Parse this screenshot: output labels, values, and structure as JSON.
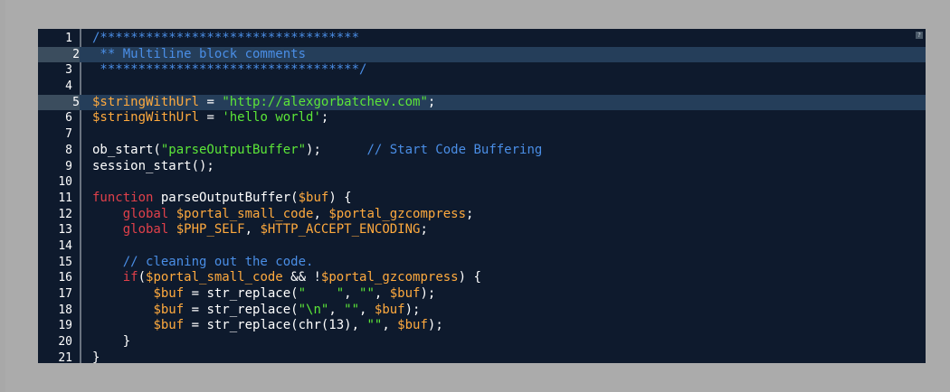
{
  "toolbar": {
    "help_label": "?"
  },
  "colors": {
    "comment": "#4a8ee6",
    "variable": "#ffaa3e",
    "string": "#5ce638",
    "keyword": "#e0404a",
    "plain": "#ffffff",
    "background": "#0e1a2d",
    "highlight": "#253e5a"
  },
  "editor": {
    "highlighted_lines": [
      2,
      5
    ],
    "lines": [
      {
        "n": "1",
        "tokens": [
          [
            "comment",
            "/**********************************"
          ]
        ]
      },
      {
        "n": "2",
        "tokens": [
          [
            "comment",
            " ** Multiline block comments"
          ]
        ]
      },
      {
        "n": "3",
        "tokens": [
          [
            "comment",
            " **********************************/"
          ]
        ]
      },
      {
        "n": "4",
        "tokens": []
      },
      {
        "n": "5",
        "tokens": [
          [
            "var",
            "$stringWithUrl"
          ],
          [
            "plain",
            " = "
          ],
          [
            "str",
            "\"http://alexgorbatchev.com\""
          ],
          [
            "plain",
            ";"
          ]
        ]
      },
      {
        "n": "6",
        "tokens": [
          [
            "var",
            "$stringWithUrl"
          ],
          [
            "plain",
            " = "
          ],
          [
            "str",
            "'hello world'"
          ],
          [
            "plain",
            ";"
          ]
        ]
      },
      {
        "n": "7",
        "tokens": []
      },
      {
        "n": "8",
        "tokens": [
          [
            "plain",
            "ob_start("
          ],
          [
            "str",
            "\"parseOutputBuffer\""
          ],
          [
            "plain",
            ");      "
          ],
          [
            "comment",
            "// Start Code Buffering"
          ]
        ]
      },
      {
        "n": "9",
        "tokens": [
          [
            "plain",
            "session_start();"
          ]
        ]
      },
      {
        "n": "10",
        "tokens": []
      },
      {
        "n": "11",
        "tokens": [
          [
            "kw",
            "function"
          ],
          [
            "plain",
            " parseOutputBuffer("
          ],
          [
            "var",
            "$buf"
          ],
          [
            "plain",
            ") {"
          ]
        ]
      },
      {
        "n": "12",
        "tokens": [
          [
            "plain",
            "    "
          ],
          [
            "kw",
            "global"
          ],
          [
            "plain",
            " "
          ],
          [
            "var",
            "$portal_small_code"
          ],
          [
            "plain",
            ", "
          ],
          [
            "var",
            "$portal_gzcompress"
          ],
          [
            "plain",
            ";"
          ]
        ]
      },
      {
        "n": "13",
        "tokens": [
          [
            "plain",
            "    "
          ],
          [
            "kw",
            "global"
          ],
          [
            "plain",
            " "
          ],
          [
            "var",
            "$PHP_SELF"
          ],
          [
            "plain",
            ", "
          ],
          [
            "var",
            "$HTTP_ACCEPT_ENCODING"
          ],
          [
            "plain",
            ";"
          ]
        ]
      },
      {
        "n": "14",
        "tokens": []
      },
      {
        "n": "15",
        "tokens": [
          [
            "plain",
            "    "
          ],
          [
            "comment",
            "// cleaning out the code."
          ]
        ]
      },
      {
        "n": "16",
        "tokens": [
          [
            "plain",
            "    "
          ],
          [
            "kw",
            "if"
          ],
          [
            "plain",
            "("
          ],
          [
            "var",
            "$portal_small_code"
          ],
          [
            "plain",
            " && !"
          ],
          [
            "var",
            "$portal_gzcompress"
          ],
          [
            "plain",
            ") {"
          ]
        ]
      },
      {
        "n": "17",
        "tokens": [
          [
            "plain",
            "        "
          ],
          [
            "var",
            "$buf"
          ],
          [
            "plain",
            " = str_replace("
          ],
          [
            "str",
            "\"    \""
          ],
          [
            "plain",
            ", "
          ],
          [
            "str",
            "\"\""
          ],
          [
            "plain",
            ", "
          ],
          [
            "var",
            "$buf"
          ],
          [
            "plain",
            ");"
          ]
        ]
      },
      {
        "n": "18",
        "tokens": [
          [
            "plain",
            "        "
          ],
          [
            "var",
            "$buf"
          ],
          [
            "plain",
            " = str_replace("
          ],
          [
            "str",
            "\"\\n\""
          ],
          [
            "plain",
            ", "
          ],
          [
            "str",
            "\"\""
          ],
          [
            "plain",
            ", "
          ],
          [
            "var",
            "$buf"
          ],
          [
            "plain",
            ");"
          ]
        ]
      },
      {
        "n": "19",
        "tokens": [
          [
            "plain",
            "        "
          ],
          [
            "var",
            "$buf"
          ],
          [
            "plain",
            " = str_replace(chr(13), "
          ],
          [
            "str",
            "\"\""
          ],
          [
            "plain",
            ", "
          ],
          [
            "var",
            "$buf"
          ],
          [
            "plain",
            ");"
          ]
        ]
      },
      {
        "n": "20",
        "tokens": [
          [
            "plain",
            "    }"
          ]
        ]
      },
      {
        "n": "21",
        "tokens": [
          [
            "plain",
            "}"
          ]
        ]
      }
    ]
  }
}
